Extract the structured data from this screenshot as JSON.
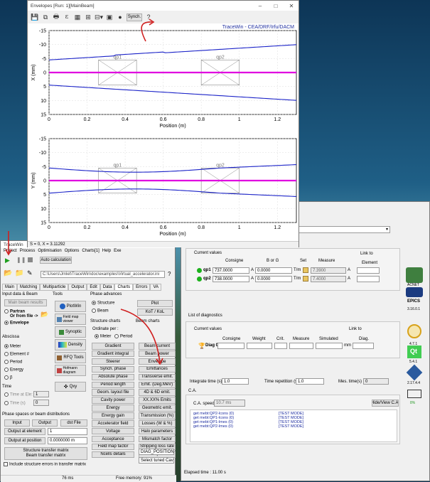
{
  "envelopes": {
    "title": "Envelopes [Run: 1][MainBeam]",
    "synch_label": "Synch.",
    "tracewin_label": "TraceWin - CEA/DRF/Irfu/DACM",
    "x_plot": {
      "ylabel": "X (mm)",
      "xlabel": "Position (m)",
      "yticks": [
        "15",
        "10",
        "5",
        "0",
        "-5",
        "-10",
        "-15"
      ],
      "xticks": [
        "0",
        "0.2",
        "0.4",
        "0.6",
        "0.8",
        "1",
        "1.2"
      ],
      "qp1": "qp1",
      "qp2": "qp2"
    },
    "y_plot": {
      "ylabel": "Y (mm)",
      "xlabel": "Position (m)",
      "yticks": [
        "15",
        "10",
        "5",
        "0",
        "-5",
        "-10",
        "-15"
      ],
      "xticks": [
        "0",
        "0.2",
        "0.4",
        "0.6",
        "0.8",
        "1",
        "1.2"
      ],
      "qp1": "qp1",
      "qp2": "qp2"
    },
    "status": "S = 0, X = 3.11292"
  },
  "tracewin": {
    "title": "TraceWin",
    "menu": [
      "Project",
      "Process",
      "Optimisation",
      "Options",
      "Charts[1]",
      "Help",
      "Exe"
    ],
    "auto_calc": "Auto calculation",
    "path": "C:\\Users\\Jmlet\\TraceWin\\doc\\examples\\Virtual_accelerator.ini",
    "tabs": [
      "Main",
      "Matching",
      "Multiparticle",
      "Output",
      "Edit",
      "Data",
      "Charts",
      "Errors",
      "VA"
    ],
    "input_title": "Input data & Beam",
    "main_beam_results": "Main beam results",
    "partran": "Partran",
    "or_from_file": "Or from file ->",
    "envelope": "Envelope",
    "tools_title": "Tools",
    "tools": [
      "PlotWin",
      "Field map viewer",
      "Synoptic",
      "Density",
      "RFQ Tools",
      "Hofmann diagram",
      "Qxy"
    ],
    "abscissa_title": "Abscissa",
    "abscissa": [
      "Meter",
      "Element #",
      "Period",
      "Energy",
      "β"
    ],
    "time_title": "Time",
    "time_at_ele": "Time at Ele:",
    "time_s": "Time (s)",
    "time_at_ele_val": "1",
    "time_s_val": "0",
    "phase_adv_title": "Phase advances",
    "structure": "Structure",
    "beam": "Beam",
    "plot_btn": "Plot",
    "kot_kol": "KoT / KoL",
    "struct_charts_title": "Structure charts",
    "ordinate_per": "Ordinate per :",
    "meter": "Meter",
    "period": "Period",
    "struct_buttons": [
      "Gradient",
      "Gradient integral",
      "Steerer",
      "Synch. phase",
      "Absolute phase",
      "Period length",
      "Geom. layout file",
      "Cavity power",
      "Energy",
      "Energy gain",
      "Accelerator field",
      "Voltage",
      "Acceptance",
      "Field map factor",
      "Ncells details"
    ],
    "beam_charts_title": "Beam charts",
    "beam_buttons": [
      "Beam current",
      "Beam power",
      "Envelope",
      "Emittances",
      "Transverse emit.",
      "Emit. (Deg.MeV)",
      "4D & 6D emit.",
      "XX.XX% Emits",
      "Geometric emit.",
      "Transmission (%)",
      "Losses (W & %)",
      "Halo parameters",
      "Mismatch factor",
      "Stripping loss rate",
      "Tune depression"
    ],
    "diag_position": "DIAG_POSITION",
    "select_tuned": "Select tuned Cav",
    "phase_spaces_title": "Phase spaces or beam distributions",
    "input_btn": "Input",
    "output_btn": "Output",
    "dst_file": "dst File",
    "output_at_element": "Output at element",
    "output_at_element_val": "1",
    "output_at_position": "Output at position",
    "output_at_position_val": "0.0000000 m",
    "struct_transfer": "Structure transfer matrix",
    "beam_transfer": "Beam transfer matrix",
    "include_errors": "Include structure errors in transfer matrix",
    "status_ms": "76 ms",
    "free_memory": "Free memory: 91%"
  },
  "va": {
    "current_values": "Current values",
    "consigne": "Consigne",
    "b_or_g": "B or G",
    "set": "Set",
    "measure": "Measure",
    "link_to": "Link to",
    "element": "Element",
    "quads": [
      {
        "name": "qp1",
        "consigne": "737.0000",
        "unit1": "A",
        "bg": "0.0000",
        "unit2": "T/m",
        "measure": "7.3900",
        "unit3": "A"
      },
      {
        "name": "qp2",
        "consigne": "738.0000",
        "unit1": "A",
        "bg": "0.0000",
        "unit2": "T/m",
        "measure": "7.4000",
        "unit3": "A"
      }
    ],
    "list_of_diag": "List of diagnostics",
    "diag_cols": [
      "Consigne",
      "Weight",
      "Crit.",
      "Measure",
      "Simulated"
    ],
    "diag_link": "Diag.",
    "diag_name": "Diag 0",
    "diag_unit": "mm",
    "integrate_time": "Integrate time (s)",
    "integrate_val": "1.0",
    "time_rep": "Time repetition (s)",
    "time_rep_val": "1.0",
    "mes_time": "Mes. time(s)",
    "mes_time_val": "0",
    "ca_title": "C.A.",
    "ca_speed": "C.A. speed",
    "ca_speed_val": "10.7 ms",
    "hide_view": "Hide/View C.A.",
    "log": [
      {
        "cmd": "get mebt:QP2-Icons (0)",
        "mode": "[TEST MODE]"
      },
      {
        "cmd": "get mebt:QP1-Icons (0)",
        "mode": "[TEST MODE]"
      },
      {
        "cmd": "get mebt:QP1-Imes (0)",
        "mode": "[TEST MODE]"
      },
      {
        "cmd": "get mebt:QP2-Imes (0)",
        "mode": "[TEST MODE]"
      }
    ],
    "elapsed": "Elapsed time : 11.00 s",
    "logos": [
      "ACNET",
      "EPICS",
      "3.16.0.1",
      "GCC",
      "4.7.1",
      "Qt",
      "5.4.1",
      "2.17.4.4",
      "8%"
    ]
  },
  "colors": {
    "envelope": "#1a22c8",
    "axis_line": "#e000e0",
    "arrow": "#d02020"
  }
}
